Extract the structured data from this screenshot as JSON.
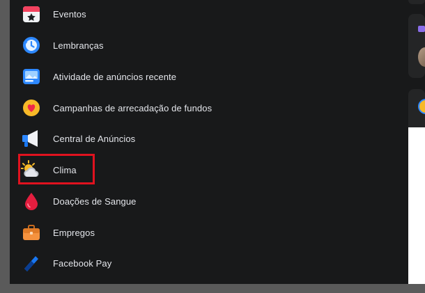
{
  "menu": {
    "items": [
      {
        "label": "Eventos",
        "icon": "calendar-star-icon"
      },
      {
        "label": "Lembranças",
        "icon": "clock-history-icon"
      },
      {
        "label": "Atividade de anúncios recente",
        "icon": "ad-activity-icon"
      },
      {
        "label": "Campanhas de arrecadação de fundos",
        "icon": "heart-coin-icon"
      },
      {
        "label": "Central de Anúncios",
        "icon": "megaphone-icon"
      },
      {
        "label": "Clima",
        "icon": "sun-cloud-icon"
      },
      {
        "label": "Doações de Sangue",
        "icon": "blood-drop-icon"
      },
      {
        "label": "Empregos",
        "icon": "briefcase-icon"
      },
      {
        "label": "Facebook Pay",
        "icon": "facebook-pay-icon"
      }
    ]
  },
  "colors": {
    "background": "#18191a",
    "text": "#e4e6eb",
    "highlight": "#e0121f",
    "card": "#242526"
  }
}
